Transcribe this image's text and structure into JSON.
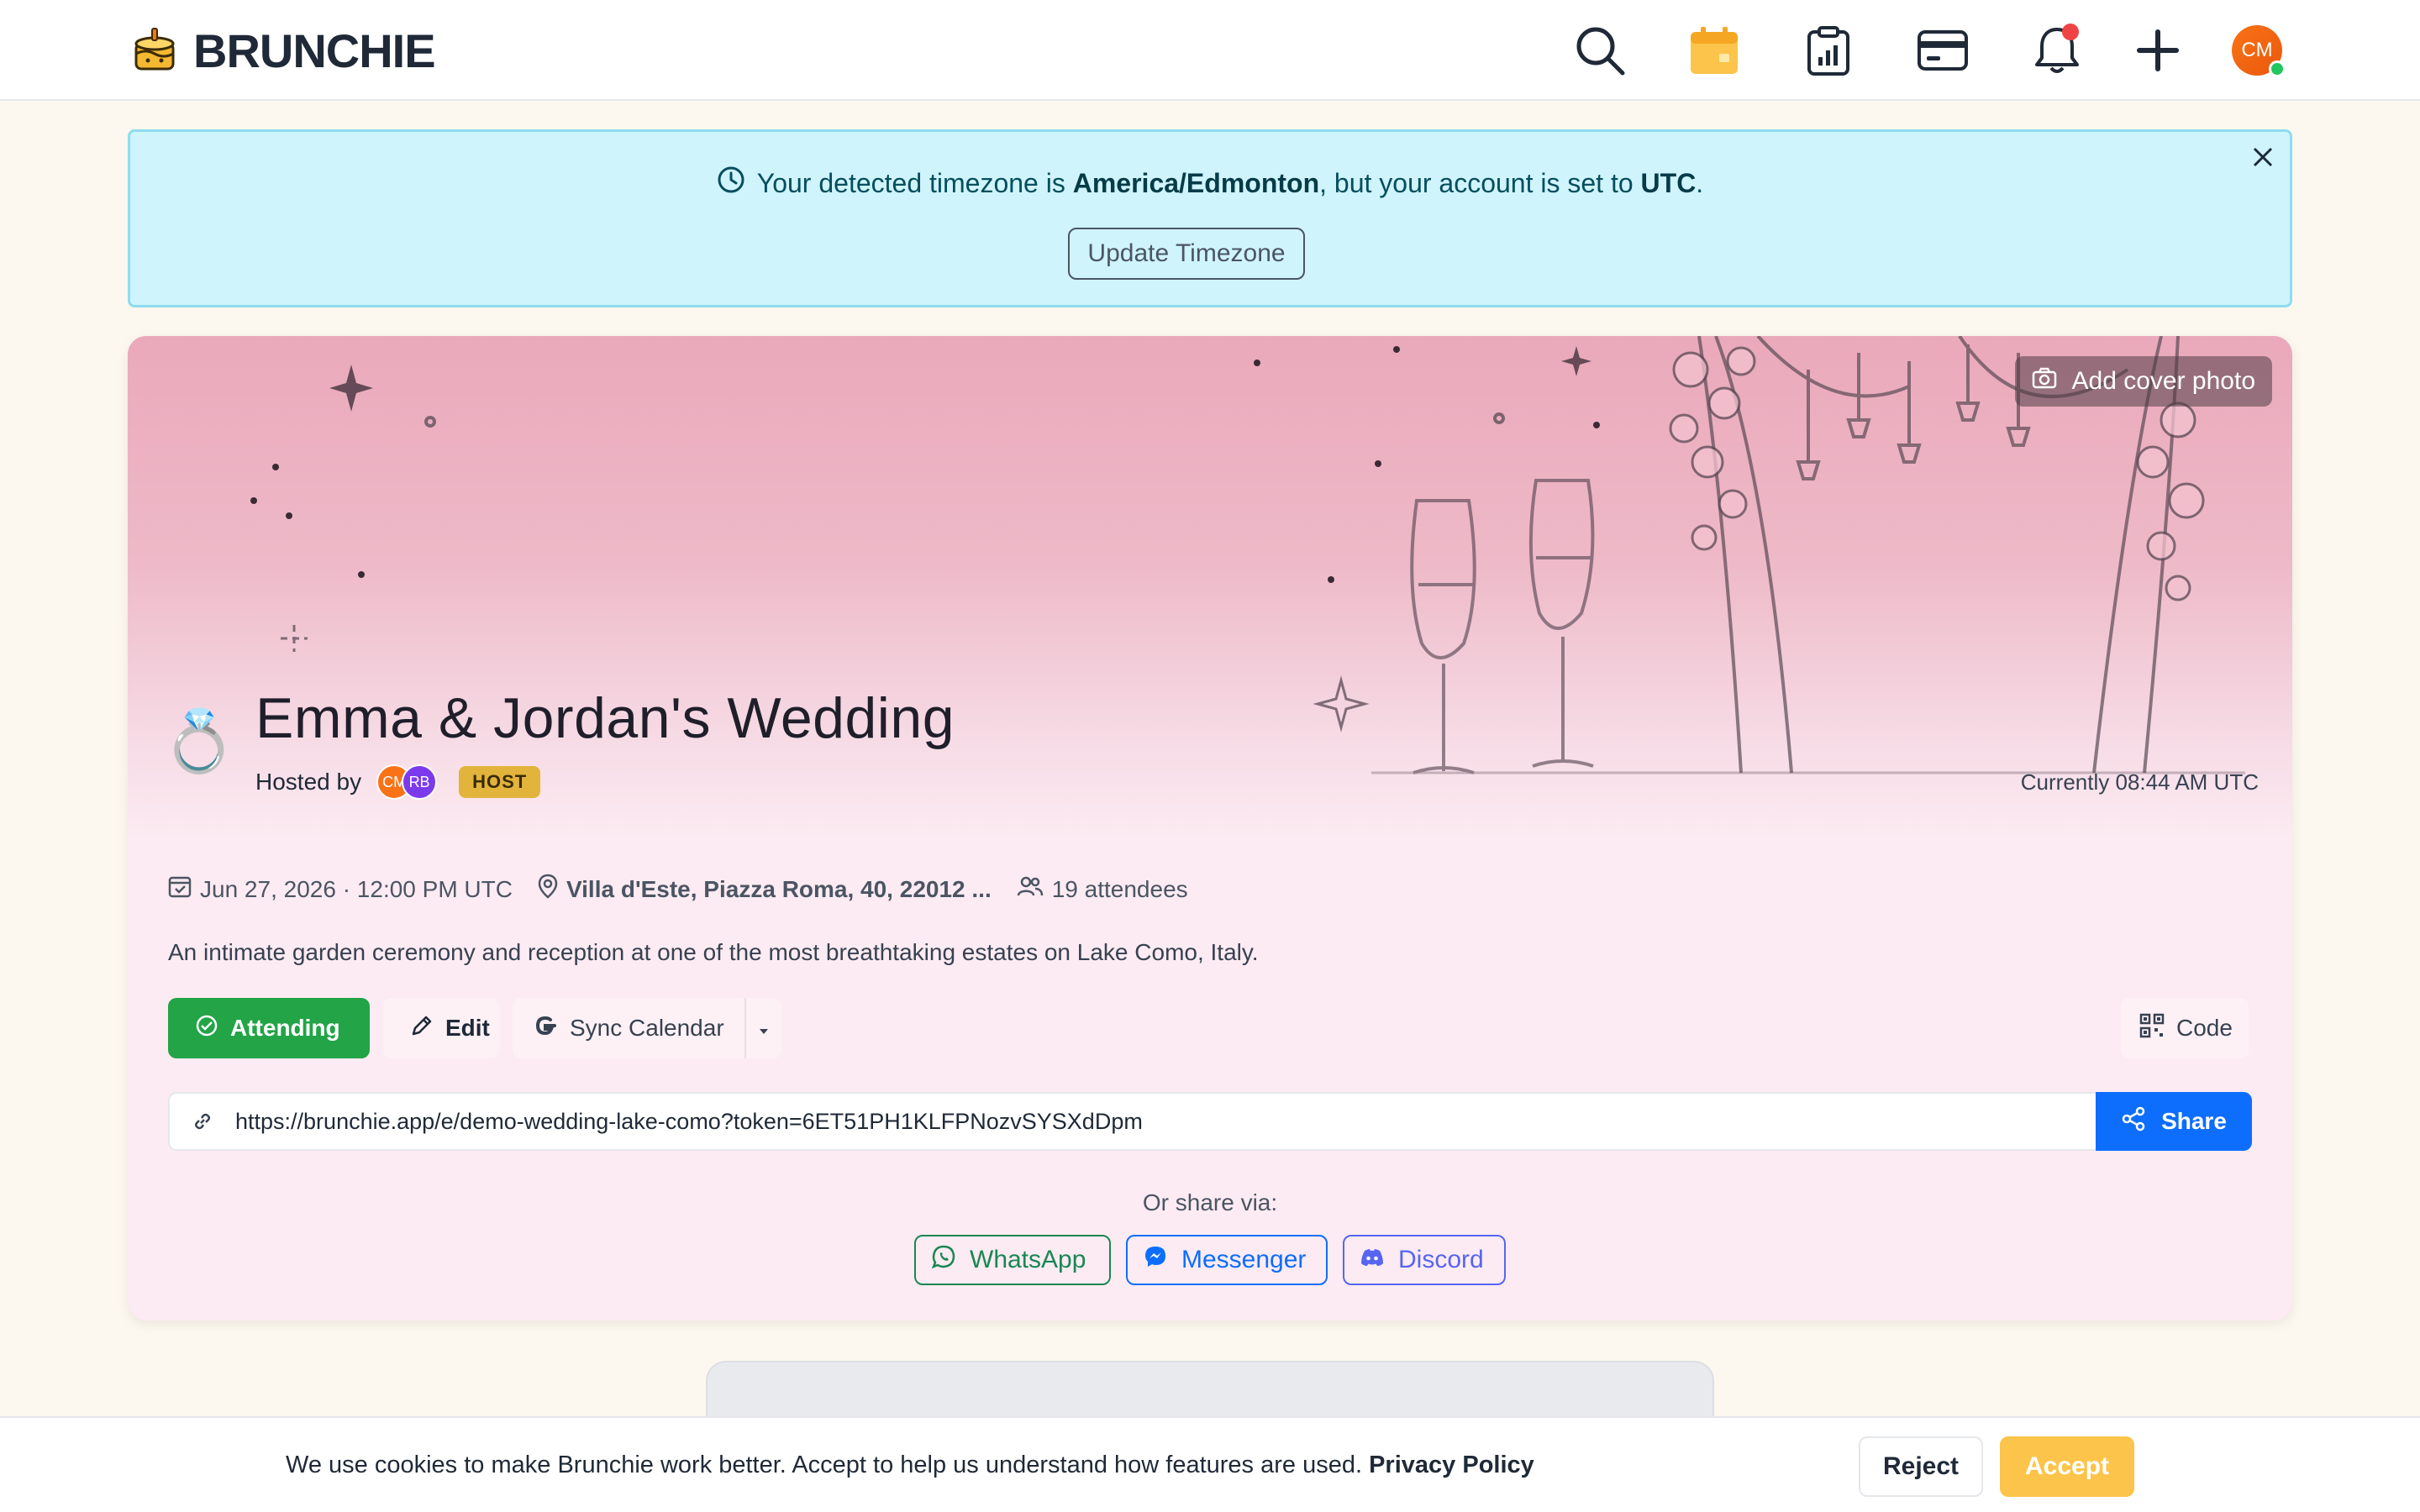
{
  "app": {
    "name": "BRUNCHIE",
    "logo_icon": "cake-logo-icon"
  },
  "nav": {
    "icons": [
      "search-icon",
      "calendar-icon",
      "clipboard-chart-icon",
      "credit-card-icon",
      "bell-icon",
      "plus-icon"
    ],
    "avatar_initials": "CM"
  },
  "timezone_banner": {
    "prefix": "Your detected timezone is ",
    "detected": "America/Edmonton",
    "middle": ", but your account is set to ",
    "account": "UTC",
    "suffix": ".",
    "button_label": "Update Timezone"
  },
  "event": {
    "add_cover_label": "Add cover photo",
    "emoji": "💍",
    "title": "Emma & Jordan's Wedding",
    "hosted_by_label": "Hosted by",
    "hosts": [
      {
        "initials": "CM",
        "color": "#f97316"
      },
      {
        "initials": "RB",
        "color": "#7c3aed"
      }
    ],
    "host_badge": "HOST",
    "current_time": "Currently 08:44 AM UTC",
    "date": "Jun 27, 2026 · 12:00 PM UTC",
    "location": "Villa d'Este, Piazza Roma, 40, 22012 ...",
    "attendees": "19 attendees",
    "description": "An intimate garden ceremony and reception at one of the most breathtaking estates on Lake Como, Italy.",
    "actions": {
      "attending": "Attending",
      "edit": "Edit",
      "sync": "Sync Calendar",
      "code": "Code"
    },
    "share_link": "https://brunchie.app/e/demo-wedding-lake-como?token=6ET51PH1KLFPNozvSYSXdDpm",
    "share_label": "Share",
    "share_via": "Or share via:",
    "share_options": {
      "whatsapp": "WhatsApp",
      "messenger": "Messenger",
      "discord": "Discord"
    }
  },
  "cookie": {
    "text": "We use cookies to make Brunchie work better. Accept to help us understand how features are used. ",
    "policy_link": "Privacy Policy",
    "reject": "Reject",
    "accept": "Accept"
  },
  "colors": {
    "accent_green": "#22a447",
    "share_blue": "#0d6efd",
    "banner_bg": "#cff4fc",
    "host_badge": "#e3b43c",
    "accept_yellow": "#fcc44a"
  }
}
